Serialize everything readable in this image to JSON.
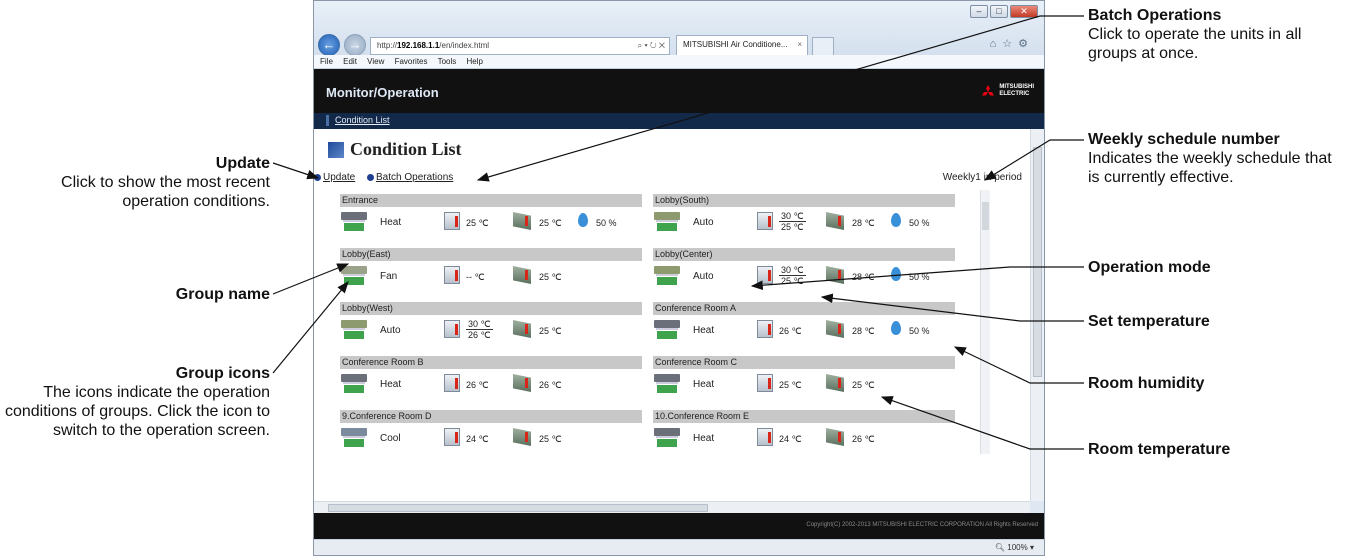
{
  "browser": {
    "address_prefix": "http://",
    "address_host": "192.168.1.1",
    "address_path": "/en/index.html",
    "address_tools": "⌕ ▾ ↻ ✕",
    "tab_title": "MITSUBISHI Air Conditione...",
    "tab_close": "×",
    "menu": [
      "File",
      "Edit",
      "View",
      "Favorites",
      "Tools",
      "Help"
    ],
    "zoom": "100%",
    "toolbar_icons": [
      "home-icon",
      "star-icon",
      "gear-icon"
    ]
  },
  "app": {
    "header_title": "Monitor/Operation",
    "logo_text": [
      "MITSUBISHI",
      "ELECTRIC"
    ],
    "subnav_item": "Condition List",
    "page_title": "Condition List",
    "update_link": "Update",
    "batch_link": "Batch Operations",
    "weekly_status": "Weekly1 in period",
    "copyright": "Copyright(C) 2002-2013 MITSUBISHI ELECTRIC CORPORATION All Rights Reserved"
  },
  "groups": [
    {
      "name": "Entrance",
      "mode": "Heat",
      "set_temp": "25 ℃",
      "room_temp": "25 ℃",
      "humidity": "50 %"
    },
    {
      "name": "Lobby(South)",
      "mode": "Auto",
      "set_temp_high": "30 ℃",
      "set_temp_low": "25 ℃",
      "room_temp": "28 ℃",
      "humidity": "50 %"
    },
    {
      "name": "Lobby(East)",
      "mode": "Fan",
      "set_temp": "-- ℃",
      "room_temp": "25 ℃"
    },
    {
      "name": "Lobby(Center)",
      "mode": "Auto",
      "set_temp_high": "30 ℃",
      "set_temp_low": "25 ℃",
      "room_temp": "28 ℃",
      "humidity": "50 %"
    },
    {
      "name": "Lobby(West)",
      "mode": "Auto",
      "set_temp_high": "30 ℃",
      "set_temp_low": "26 ℃",
      "room_temp": "25 ℃"
    },
    {
      "name": "Conference Room A",
      "mode": "Heat",
      "set_temp": "26 ℃",
      "room_temp": "28 ℃",
      "humidity": "50 %"
    },
    {
      "name": "Conference Room B",
      "mode": "Heat",
      "set_temp": "26 ℃",
      "room_temp": "26 ℃"
    },
    {
      "name": "Conference Room C",
      "mode": "Heat",
      "set_temp": "25 ℃",
      "room_temp": "25 ℃"
    },
    {
      "name": "9.Conference Room D",
      "mode": "Cool",
      "set_temp": "24 ℃",
      "room_temp": "25 ℃"
    },
    {
      "name": "10.Conference Room E",
      "mode": "Heat",
      "set_temp": "24 ℃",
      "room_temp": "26 ℃"
    }
  ],
  "annotations": {
    "update_title": "Update",
    "update_desc": "Click to show the most recent operation conditions.",
    "group_name": "Group name",
    "group_icons_title": "Group icons",
    "group_icons_desc": "The icons indicate the operation conditions of groups. Click the icon to switch to the operation screen.",
    "batch_title": "Batch Operations",
    "batch_desc": "Click to operate the units in all groups at once.",
    "weekly_title": "Weekly schedule number",
    "weekly_desc": "Indicates the weekly schedule that is currently effective.",
    "operation_mode": "Operation mode",
    "set_temperature": "Set temperature",
    "room_humidity": "Room humidity",
    "room_temperature": "Room temperature"
  }
}
